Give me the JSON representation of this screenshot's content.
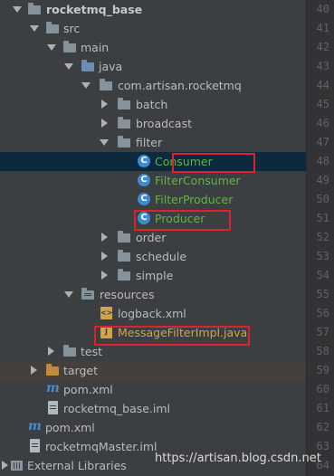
{
  "tree": {
    "rows": [
      {
        "label": "rocketmq_base"
      },
      {
        "label": "src"
      },
      {
        "label": "main"
      },
      {
        "label": "java"
      },
      {
        "label": "com.artisan.rocketmq"
      },
      {
        "label": "batch"
      },
      {
        "label": "broadcast"
      },
      {
        "label": "filter"
      },
      {
        "label": "Consumer",
        "icon_letter": "C"
      },
      {
        "label": "FilterConsumer",
        "icon_letter": "C"
      },
      {
        "label": "FilterProducer",
        "icon_letter": "C"
      },
      {
        "label": "Producer",
        "icon_letter": "C"
      },
      {
        "label": "order"
      },
      {
        "label": "schedule"
      },
      {
        "label": "simple"
      },
      {
        "label": "resources"
      },
      {
        "label": "logback.xml",
        "icon_letter": "<>"
      },
      {
        "label": "MessageFilterImpl.java",
        "icon_letter": "J"
      },
      {
        "label": "test"
      },
      {
        "label": "target"
      },
      {
        "label": "pom.xml",
        "icon_letter": "m"
      },
      {
        "label": "rocketmq_base.iml"
      },
      {
        "label": "pom.xml",
        "icon_letter": "m"
      },
      {
        "label": "rocketmqMaster.iml"
      },
      {
        "label": "External Libraries"
      }
    ]
  },
  "gutter": {
    "line_numbers": [
      "40",
      "41",
      "42",
      "43",
      "44",
      "45",
      "46",
      "47",
      "48",
      "49",
      "50",
      "51",
      "52",
      "53",
      "54",
      "55",
      "56",
      "57",
      "58",
      "59",
      "60",
      "61",
      "62",
      "63",
      "64"
    ]
  },
  "watermark": "https://artisan.blog.csdn.net",
  "colors": {
    "background": "#3c3f41",
    "selection": "#0d293e",
    "modified_green": "#62b543",
    "highlight_red": "#e0212c"
  }
}
